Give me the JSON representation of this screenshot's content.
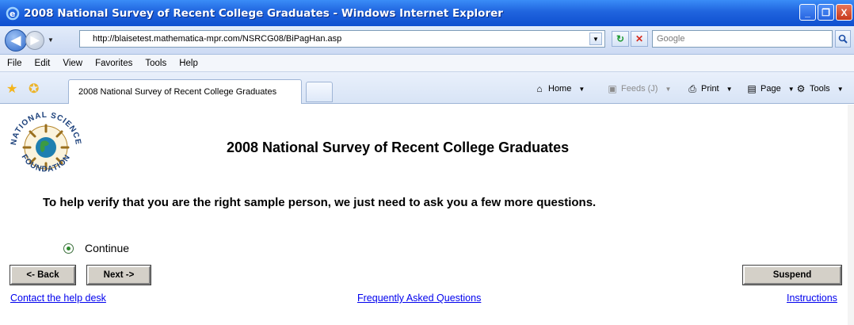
{
  "window": {
    "title": "2008 National Survey of Recent College Graduates - Windows Internet Explorer",
    "minimize": "_",
    "maximize": "❐",
    "close": "X"
  },
  "address": {
    "url": "http://blaisetest.mathematica-mpr.com/NSRCG08/BiPagHan.asp",
    "search_placeholder": "Google"
  },
  "menu": [
    "File",
    "Edit",
    "View",
    "Favorites",
    "Tools",
    "Help"
  ],
  "tabs": {
    "active_label": "2008 National Survey of Recent College Graduates"
  },
  "commands": {
    "home": "Home",
    "feeds": "Feeds (J)",
    "print": "Print",
    "page": "Page",
    "tools": "Tools"
  },
  "page": {
    "logo_text_top": "NATIONAL SCIENCE",
    "logo_text_bottom": "FOUNDATION",
    "title": "2008 National Survey of Recent College Graduates",
    "question": "To help verify that you are the right sample person, we just need to ask you a few more questions.",
    "option_label": "Continue",
    "buttons": {
      "back": "<- Back",
      "next": "Next ->",
      "suspend": "Suspend"
    },
    "links": {
      "help": "Contact the help desk",
      "faq": "Frequently Asked Questions",
      "instructions": "Instructions"
    }
  },
  "colors": {
    "titlebar": "#1f64de",
    "link": "#0000ee",
    "button_face": "#d4d0c8"
  }
}
